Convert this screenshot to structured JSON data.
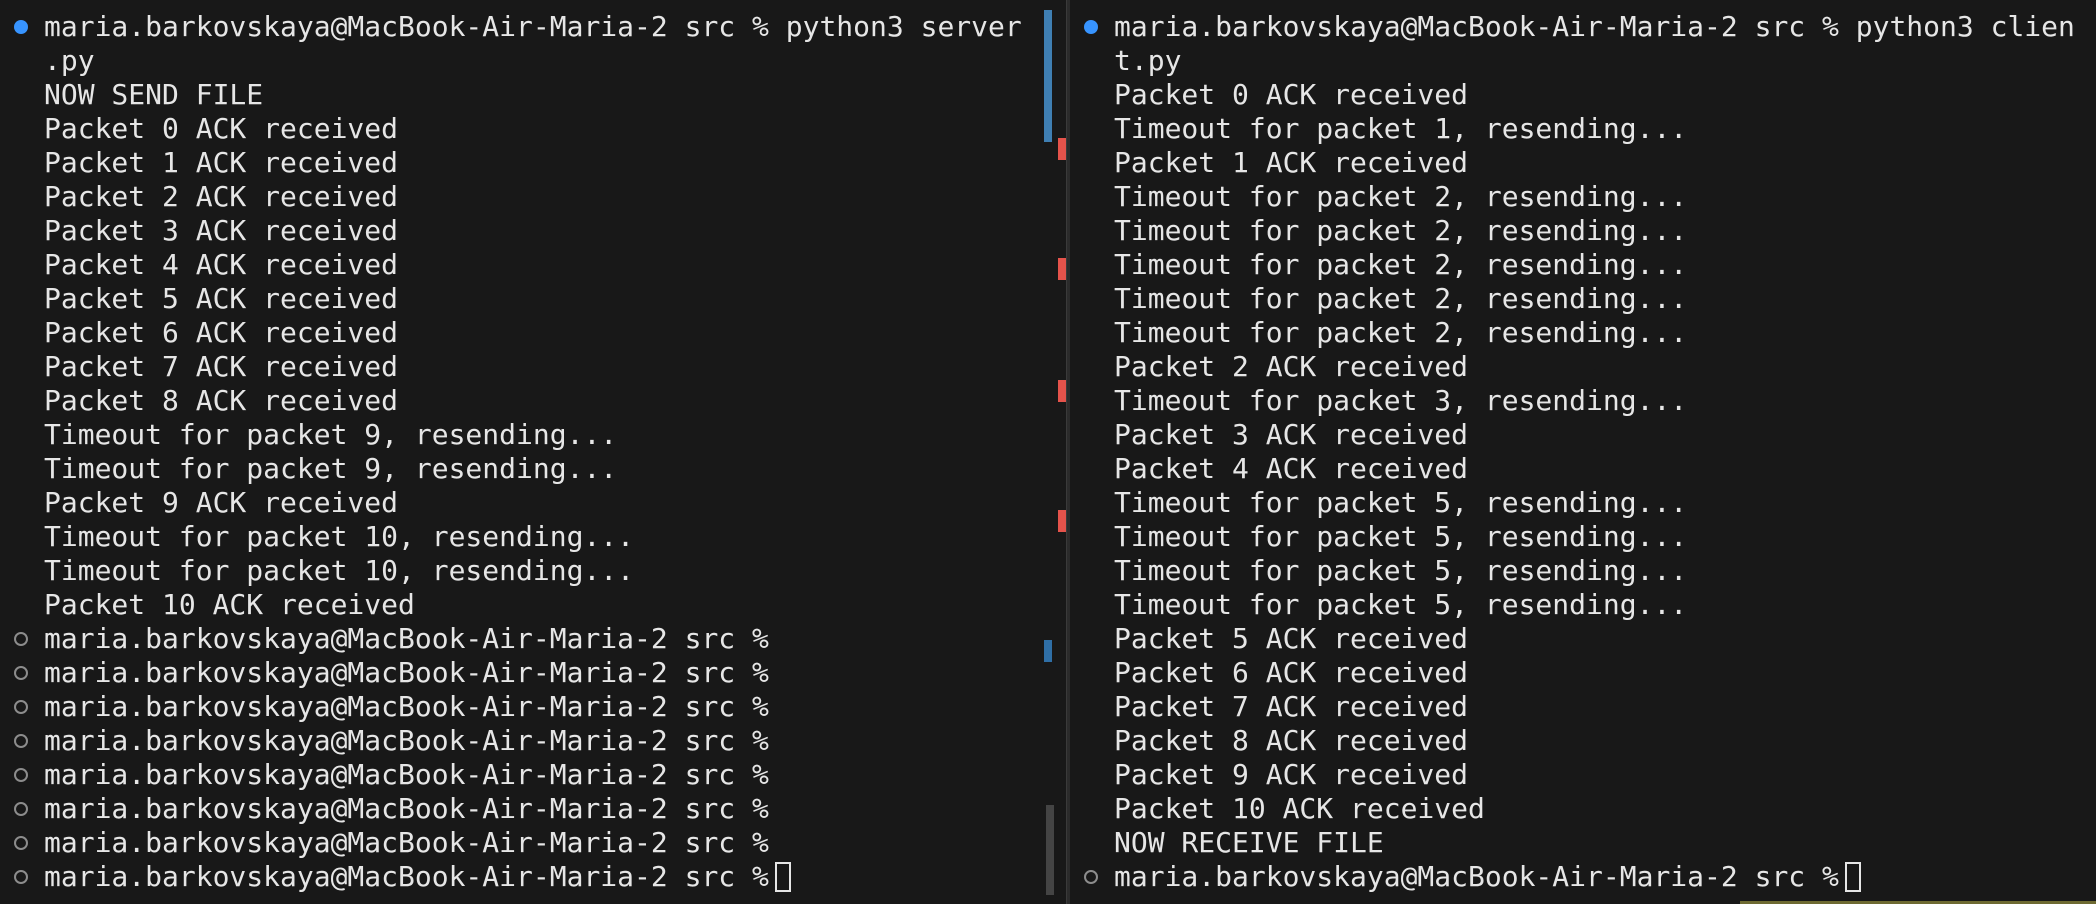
{
  "left_pane": {
    "lines": [
      {
        "deco": "success",
        "text": "maria.barkovskaya@MacBook-Air-Maria-2 src % python3 server"
      },
      {
        "deco": "none",
        "text": ".py"
      },
      {
        "deco": "none",
        "text": "NOW SEND FILE"
      },
      {
        "deco": "none",
        "text": "Packet 0 ACK received"
      },
      {
        "deco": "none",
        "text": "Packet 1 ACK received"
      },
      {
        "deco": "none",
        "text": "Packet 2 ACK received"
      },
      {
        "deco": "none",
        "text": "Packet 3 ACK received"
      },
      {
        "deco": "none",
        "text": "Packet 4 ACK received"
      },
      {
        "deco": "none",
        "text": "Packet 5 ACK received"
      },
      {
        "deco": "none",
        "text": "Packet 6 ACK received"
      },
      {
        "deco": "none",
        "text": "Packet 7 ACK received"
      },
      {
        "deco": "none",
        "text": "Packet 8 ACK received"
      },
      {
        "deco": "none",
        "text": "Timeout for packet 9, resending..."
      },
      {
        "deco": "none",
        "text": "Timeout for packet 9, resending..."
      },
      {
        "deco": "none",
        "text": "Packet 9 ACK received"
      },
      {
        "deco": "none",
        "text": "Timeout for packet 10, resending..."
      },
      {
        "deco": "none",
        "text": "Timeout for packet 10, resending..."
      },
      {
        "deco": "none",
        "text": "Packet 10 ACK received"
      },
      {
        "deco": "empty",
        "text": "maria.barkovskaya@MacBook-Air-Maria-2 src %"
      },
      {
        "deco": "empty",
        "text": "maria.barkovskaya@MacBook-Air-Maria-2 src %"
      },
      {
        "deco": "empty",
        "text": "maria.barkovskaya@MacBook-Air-Maria-2 src %"
      },
      {
        "deco": "empty",
        "text": "maria.barkovskaya@MacBook-Air-Maria-2 src %"
      },
      {
        "deco": "empty",
        "text": "maria.barkovskaya@MacBook-Air-Maria-2 src %"
      },
      {
        "deco": "empty",
        "text": "maria.barkovskaya@MacBook-Air-Maria-2 src %"
      },
      {
        "deco": "empty",
        "text": "maria.barkovskaya@MacBook-Air-Maria-2 src %"
      },
      {
        "deco": "empty",
        "text": "maria.barkovskaya@MacBook-Air-Maria-2 src %",
        "cursor": true
      }
    ]
  },
  "right_pane": {
    "lines": [
      {
        "deco": "success",
        "text": "maria.barkovskaya@MacBook-Air-Maria-2 src % python3 clien"
      },
      {
        "deco": "none",
        "text": "t.py"
      },
      {
        "deco": "none",
        "text": "Packet 0 ACK received"
      },
      {
        "deco": "none",
        "text": "Timeout for packet 1, resending..."
      },
      {
        "deco": "none",
        "text": "Packet 1 ACK received"
      },
      {
        "deco": "none",
        "text": "Timeout for packet 2, resending..."
      },
      {
        "deco": "none",
        "text": "Timeout for packet 2, resending..."
      },
      {
        "deco": "none",
        "text": "Timeout for packet 2, resending..."
      },
      {
        "deco": "none",
        "text": "Timeout for packet 2, resending..."
      },
      {
        "deco": "none",
        "text": "Timeout for packet 2, resending..."
      },
      {
        "deco": "none",
        "text": "Packet 2 ACK received"
      },
      {
        "deco": "none",
        "text": "Timeout for packet 3, resending..."
      },
      {
        "deco": "none",
        "text": "Packet 3 ACK received"
      },
      {
        "deco": "none",
        "text": "Packet 4 ACK received"
      },
      {
        "deco": "none",
        "text": "Timeout for packet 5, resending..."
      },
      {
        "deco": "none",
        "text": "Timeout for packet 5, resending..."
      },
      {
        "deco": "none",
        "text": "Timeout for packet 5, resending..."
      },
      {
        "deco": "none",
        "text": "Timeout for packet 5, resending..."
      },
      {
        "deco": "none",
        "text": "Packet 5 ACK received"
      },
      {
        "deco": "none",
        "text": "Packet 6 ACK received"
      },
      {
        "deco": "none",
        "text": "Packet 7 ACK received"
      },
      {
        "deco": "none",
        "text": "Packet 8 ACK received"
      },
      {
        "deco": "none",
        "text": "Packet 9 ACK received"
      },
      {
        "deco": "none",
        "text": "Packet 10 ACK received"
      },
      {
        "deco": "none",
        "text": "NOW RECEIVE FILE"
      },
      {
        "deco": "empty",
        "text": "maria.barkovskaya@MacBook-Air-Maria-2 src %",
        "cursor": true
      }
    ]
  },
  "colors": {
    "background": "#181818",
    "text": "#e6e6e6",
    "success_decoration": "#3794ff",
    "error_mark": "#e5534b"
  }
}
